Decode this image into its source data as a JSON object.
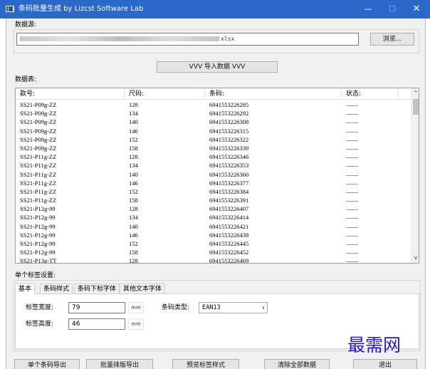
{
  "window": {
    "title": "条码批量生成   by Lizcst Software Lab",
    "minimize": "—",
    "maximize": "☐",
    "close": "✕"
  },
  "source": {
    "group_label": "数据源:",
    "file_path_visible": "xlsx",
    "browse_label": "浏览..."
  },
  "import": {
    "label": "VVV  导入数据  VVV"
  },
  "table": {
    "group_label": "数据表:",
    "columns": [
      "款号:",
      "尺码:",
      "条码:",
      "状态:"
    ],
    "rows": [
      [
        "SS21-P09g-ZZ",
        "128",
        "6941553226285",
        "——"
      ],
      [
        "SS21-P09g-ZZ",
        "134",
        "6941553226292",
        "——"
      ],
      [
        "SS21-P09g-ZZ",
        "140",
        "6941553226308",
        "——"
      ],
      [
        "SS21-P09g-ZZ",
        "146",
        "6941553226315",
        "——"
      ],
      [
        "SS21-P09g-ZZ",
        "152",
        "6941553226322",
        "——"
      ],
      [
        "SS21-P09g-ZZ",
        "158",
        "6941553226339",
        "——"
      ],
      [
        "SS21-P11g-ZZ",
        "128",
        "6941553226346",
        "——"
      ],
      [
        "SS21-P11g-ZZ",
        "134",
        "6941553226353",
        "——"
      ],
      [
        "SS21-P11g-ZZ",
        "140",
        "6941553226360",
        "——"
      ],
      [
        "SS21-P11g-ZZ",
        "146",
        "6941553226377",
        "——"
      ],
      [
        "SS21-P11g-ZZ",
        "152",
        "6941553226384",
        "——"
      ],
      [
        "SS21-P11g-ZZ",
        "158",
        "6941553226391",
        "——"
      ],
      [
        "SS21-P12g-99",
        "128",
        "6941553226407",
        "——"
      ],
      [
        "SS21-P12g-99",
        "134",
        "6941553226414",
        "——"
      ],
      [
        "SS21-P12g-99",
        "140",
        "6941553226421",
        "——"
      ],
      [
        "SS21-P12g-99",
        "146",
        "6941553226438",
        "——"
      ],
      [
        "SS21-P12g-99",
        "152",
        "6941553226445",
        "——"
      ],
      [
        "SS21-P12g-99",
        "158",
        "6941553226452",
        "——"
      ],
      [
        "SS21-P13g-TT",
        "128",
        "6941553226469",
        "——"
      ]
    ]
  },
  "label_settings": {
    "group_label": "单个标签设置:",
    "tabs": [
      "基本",
      "条码样式",
      "条码下标字体",
      "其他文本字体"
    ],
    "active_tab": 0,
    "width_label": "标签宽度:",
    "width_value": "79",
    "height_label": "标签高度:",
    "height_value": "46",
    "unit": "mm",
    "barcode_type_label": "条码类型:",
    "barcode_type_value": "EAN13"
  },
  "actions": {
    "export_single": "单个条码导出",
    "batch_export": "批量排版导出",
    "preview_style": "预览标签样式",
    "clear_all": "清除全部数据",
    "exit": "退出"
  },
  "watermark": "最需网",
  "icons": {
    "scroll_up": "^",
    "scroll_down": "v",
    "dropdown": "∨"
  },
  "colors": {
    "titlebar": "#2a68c9",
    "watermark": "#2417c9"
  }
}
